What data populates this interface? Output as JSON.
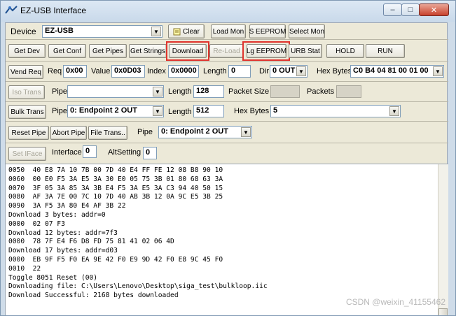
{
  "window": {
    "title": "EZ-USB Interface",
    "minimize": "–",
    "maximize": "□",
    "close": "✕"
  },
  "row1": {
    "device_label": "Device",
    "device_value": "EZ-USB",
    "clear_label": "Clear",
    "load_mon_label": "Load Mon",
    "s_eeprom_label": "S EEPROM",
    "select_mon_label": "Select Mon"
  },
  "row2": {
    "get_dev": "Get Dev",
    "get_conf": "Get Conf",
    "get_pipes": "Get Pipes",
    "get_strings": "Get Strings",
    "download": "Download",
    "reload": "Re-Load",
    "lg_eeprom": "Lg EEPROM",
    "urb_stat": "URB Stat",
    "hold": "HOLD",
    "run": "RUN"
  },
  "row3": {
    "vend_req": "Vend Req",
    "req_label": "Req",
    "req_value": "0x00",
    "value_label": "Value",
    "value_value": "0x0D03",
    "index_label": "Index",
    "index_value": "0x0000",
    "length_label": "Length",
    "length_value": "0",
    "dir_label": "Dir",
    "dir_value": "0 OUT",
    "hex_label": "Hex Bytes",
    "hex_value": "C0 B4 04 81 00 01 00"
  },
  "row4": {
    "iso_trans": "Iso Trans",
    "pipe_label": "Pipe",
    "pipe_value": "",
    "length_label": "Length",
    "length_value": "128",
    "packet_size_label": "Packet Size",
    "packet_size_value": "",
    "packets_label": "Packets",
    "packets_value": ""
  },
  "row5": {
    "bulk_trans": "Bulk Trans",
    "pipe_label": "Pipe",
    "pipe_value": "0: Endpoint 2 OUT",
    "length_label": "Length",
    "length_value": "512",
    "hex_label": "Hex Bytes",
    "hex_value": "5"
  },
  "row6": {
    "reset_pipe": "Reset Pipe",
    "abort_pipe": "Abort Pipe",
    "file_trans": "File Trans..",
    "pipe_label": "Pipe",
    "pipe_value": "0: Endpoint 2 OUT"
  },
  "row7": {
    "set_iface": "Set IFace",
    "interface_label": "Interface",
    "interface_value": "0",
    "altsetting_label": "AltSetting",
    "altsetting_value": "0"
  },
  "log": {
    "lines": [
      "0050  40 E8 7A 10 7B 00 7D 40 E4 FF FE 12 08 B8 90 10",
      "0060  00 E0 F5 3A E5 3A 30 E0 05 75 3B 01 80 68 63 3A",
      "0070  3F 05 3A 85 3A 3B E4 F5 3A E5 3A C3 94 40 50 15",
      "0080  AF 3A 7E 00 7C 10 7D 40 AB 3B 12 0A 9C E5 3B 25",
      "0090  3A F5 3A 80 E4 AF 3B 22",
      "Download 3 bytes: addr=0",
      "0000  02 07 F3",
      "Download 12 bytes: addr=7f3",
      "0000  78 7F E4 F6 D8 FD 75 81 41 02 06 4D",
      "Download 17 bytes: addr=d03",
      "0000  EB 9F F5 F0 EA 9E 42 F0 E9 9D 42 F0 E8 9C 45 F0",
      "0010  22",
      "Toggle 8051 Reset (00)",
      "Downloading file: C:\\Users\\Lenovo\\Desktop\\siga_test\\bulkloop.iic",
      "Download Successful: 2168 bytes downloaded"
    ]
  },
  "watermark": "CSDN @weixin_41155462",
  "colors": {
    "highlight": "#e0332d",
    "client_bg": "#ece9d8",
    "frame_bg": "#cfdce9"
  }
}
